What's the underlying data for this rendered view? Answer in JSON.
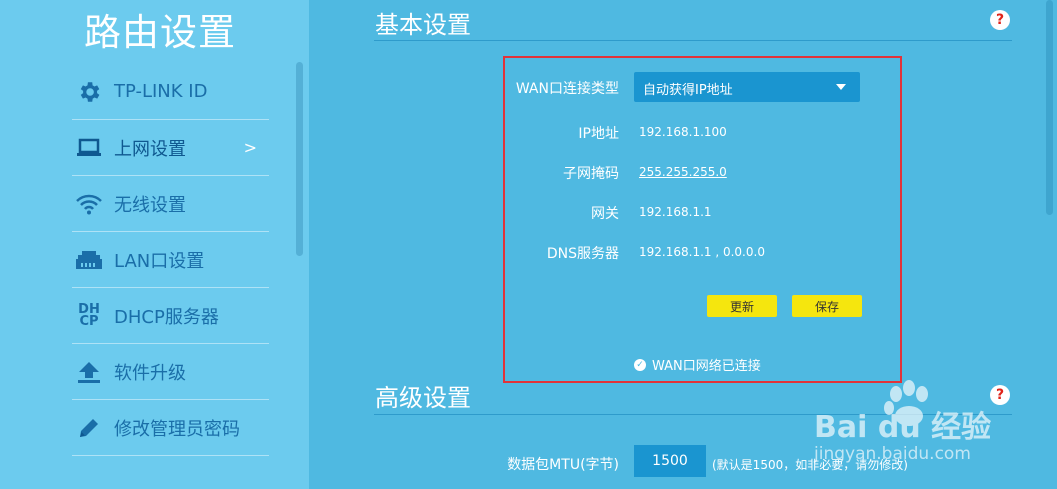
{
  "sidebar": {
    "title": "路由设置",
    "items": [
      {
        "label": "TP-LINK ID",
        "icon": "gear-icon"
      },
      {
        "label": "上网设置",
        "icon": "laptop-icon",
        "arrow": ">"
      },
      {
        "label": "无线设置",
        "icon": "wifi-icon"
      },
      {
        "label": "LAN口设置",
        "icon": "lan-port-icon"
      },
      {
        "label": "DHCP服务器",
        "icon": "dhcp-icon",
        "icon_text_top": "DH",
        "icon_text_bottom": "CP"
      },
      {
        "label": "软件升级",
        "icon": "upload-icon"
      },
      {
        "label": "修改管理员密码",
        "icon": "pencil-icon"
      }
    ]
  },
  "basic": {
    "title": "基本设置",
    "help": "?",
    "wan_type_label": "WAN口连接类型",
    "wan_type_value": "自动获得IP地址",
    "ip_label": "IP地址",
    "ip_value": "192.168.1.100",
    "mask_label": "子网掩码",
    "mask_value": "255.255.255.0",
    "gateway_label": "网关",
    "gateway_value": "192.168.1.1",
    "dns_label": "DNS服务器",
    "dns_value": "192.168.1.1 , 0.0.0.0",
    "refresh_label": "更新",
    "save_label": "保存",
    "status_text": "WAN口网络已连接"
  },
  "advanced": {
    "title": "高级设置",
    "help": "?",
    "mtu_label": "数据包MTU(字节)",
    "mtu_value": "1500",
    "mtu_hint": "(默认是1500，如非必要，请勿修改)"
  },
  "watermark": {
    "brand": "Bai du 经验",
    "url": "jingyan.baidu.com"
  },
  "colors": {
    "sidebar_bg": "#6ccbee",
    "main_bg": "#4fb9e1",
    "icon_blue": "#1a6ea8",
    "highlight_box": "#e2333a",
    "button_yellow": "#f5e60e",
    "input_bg": "#1a95d0"
  }
}
